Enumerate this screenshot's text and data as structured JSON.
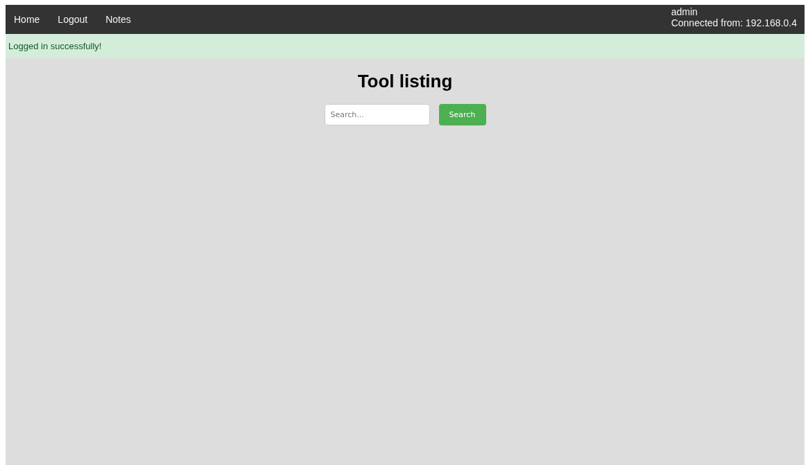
{
  "nav": {
    "links": [
      {
        "label": "Home"
      },
      {
        "label": "Logout"
      },
      {
        "label": "Notes"
      }
    ],
    "user": "admin",
    "connection": "Connected from: 192.168.0.4"
  },
  "alert": {
    "message": "Logged in successfully!"
  },
  "title": "Tool listing",
  "search": {
    "placeholder": "Search...",
    "button": "Search"
  }
}
